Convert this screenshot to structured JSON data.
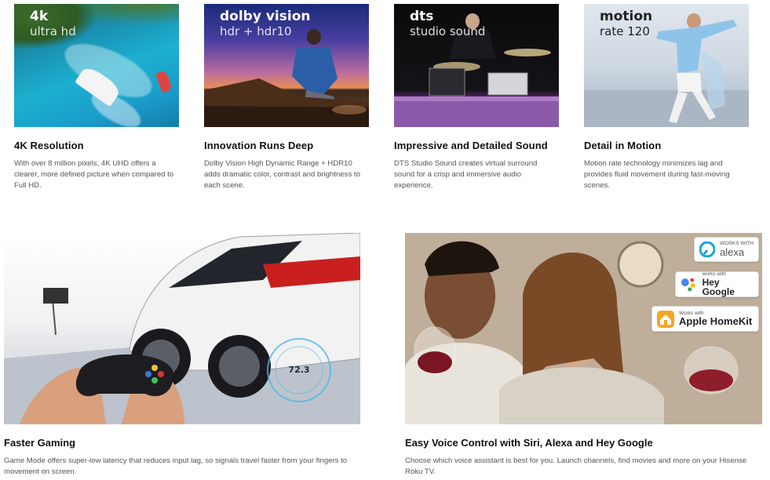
{
  "features_top": [
    {
      "overlay_big": "4k",
      "overlay_small": "ultra hd",
      "title": "4K Resolution",
      "description": "With over 8 million pixels, 4K UHD offers a clearer, more defined picture when compared to Full HD."
    },
    {
      "overlay_big": "dolby vision",
      "overlay_small": "hdr + hdr10",
      "title": "Innovation Runs Deep",
      "description": "Dolby Vision High Dynamic Range + HDR10 adds dramatic color, contrast and brightness to each scene."
    },
    {
      "overlay_big": "dts",
      "overlay_small": "studio sound",
      "title": "Impressive and Detailed Sound",
      "description": "DTS Studio Sound creates virtual surround sound for a crisp and immersive audio experience."
    },
    {
      "overlay_big": "motion",
      "overlay_small": "rate 120",
      "title": "Detail in Motion",
      "description": "Motion rate technology minimizes lag and provides fluid movement during fast-moving scenes."
    }
  ],
  "features_bottom": [
    {
      "title": "Faster Gaming",
      "description": "Game Mode offers super-low latency that reduces input lag, so signals travel faster from your fingers to movement on screen.",
      "speed_readout": "72.3"
    },
    {
      "title": "Easy Voice Control with Siri, Alexa and Hey Google",
      "description": "Choose which voice assistant is best for you. Launch channels, find movies and more on your Hisense Roku TV.",
      "badges": {
        "alexa": {
          "small": "WORKS WITH",
          "big": "alexa",
          "icon": "alexa-icon"
        },
        "google": {
          "small": "works with",
          "big": "Hey Google",
          "icon": "google-assistant-icon"
        },
        "homekit": {
          "small": "Works with",
          "big": "Apple HomeKit",
          "icon": "homekit-icon"
        }
      }
    }
  ],
  "colors": {
    "title": "#111111",
    "description": "#555555",
    "alexa_blue": "#1aa3d9",
    "homekit_orange": "#f5a623"
  }
}
